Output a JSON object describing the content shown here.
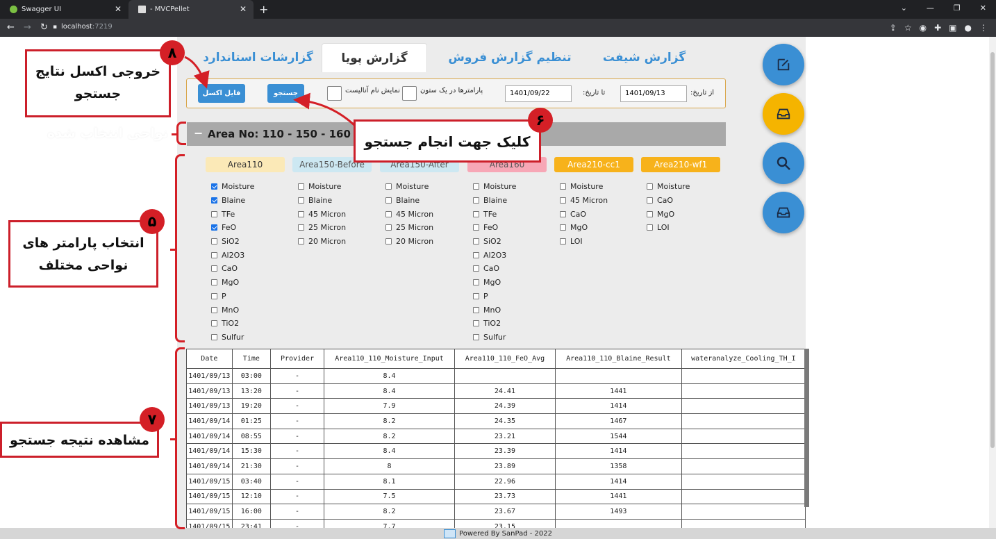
{
  "browser": {
    "tabs": [
      {
        "title": "Swagger UI"
      },
      {
        "title": "- MVCPellet"
      }
    ],
    "new_tab": "+",
    "url_host": "localhost",
    "url_port": ":7219"
  },
  "nav": {
    "tabs": [
      "گزارش شیفت",
      "تنظیم گزارش فروش",
      "گزارش پویا",
      "گزارشات استاندارد"
    ],
    "active": "گزارش پویا"
  },
  "filter": {
    "from_label": "از تاریخ:",
    "from_value": "1401/09/13",
    "to_label": "تا تاریخ:",
    "to_value": "1401/09/22",
    "one_column_label": "پارامترها در یک ستون",
    "show_analyst_label": "نمایش نام آنالیست",
    "search_button": "جستجو",
    "excel_button": "فایل اکسل"
  },
  "area_bar": {
    "toggle": "−",
    "title": "Area No: 110 - 150 - 160"
  },
  "areas": [
    {
      "name": "Area110",
      "color": "#fbe9b7",
      "text": "#333333",
      "params": [
        {
          "label": "Moisture",
          "checked": true
        },
        {
          "label": "Blaine",
          "checked": true
        },
        {
          "label": "TFe",
          "checked": false
        },
        {
          "label": "FeO",
          "checked": true
        },
        {
          "label": "SiO2",
          "checked": false
        },
        {
          "label": "Al2O3",
          "checked": false
        },
        {
          "label": "CaO",
          "checked": false
        },
        {
          "label": "MgO",
          "checked": false
        },
        {
          "label": "P",
          "checked": false
        },
        {
          "label": "MnO",
          "checked": false
        },
        {
          "label": "TiO2",
          "checked": false
        },
        {
          "label": "Sulfur",
          "checked": false
        }
      ]
    },
    {
      "name": "Area150-Before",
      "color": "#cde8f2",
      "text": "#555555",
      "params": [
        {
          "label": "Moisture",
          "checked": false
        },
        {
          "label": "Blaine",
          "checked": false
        },
        {
          "label": "45 Micron",
          "checked": false
        },
        {
          "label": "25 Micron",
          "checked": false
        },
        {
          "label": "20 Micron",
          "checked": false
        }
      ]
    },
    {
      "name": "Area150-After",
      "color": "#cde8f2",
      "text": "#555555",
      "params": [
        {
          "label": "Moisture",
          "checked": false
        },
        {
          "label": "Blaine",
          "checked": false
        },
        {
          "label": "45 Micron",
          "checked": false
        },
        {
          "label": "25 Micron",
          "checked": false
        },
        {
          "label": "20 Micron",
          "checked": false
        }
      ]
    },
    {
      "name": "Area160",
      "color": "#f7a7b6",
      "text": "#555555",
      "params": [
        {
          "label": "Moisture",
          "checked": false
        },
        {
          "label": "Blaine",
          "checked": false
        },
        {
          "label": "TFe",
          "checked": false
        },
        {
          "label": "FeO",
          "checked": false
        },
        {
          "label": "SiO2",
          "checked": false
        },
        {
          "label": "Al2O3",
          "checked": false
        },
        {
          "label": "CaO",
          "checked": false
        },
        {
          "label": "MgO",
          "checked": false
        },
        {
          "label": "P",
          "checked": false
        },
        {
          "label": "MnO",
          "checked": false
        },
        {
          "label": "TiO2",
          "checked": false
        },
        {
          "label": "Sulfur",
          "checked": false
        }
      ]
    },
    {
      "name": "Area210-cc1",
      "color": "#f7b21b",
      "text": "#ffffff",
      "params": [
        {
          "label": "Moisture",
          "checked": false
        },
        {
          "label": "45 Micron",
          "checked": false
        },
        {
          "label": "CaO",
          "checked": false
        },
        {
          "label": "MgO",
          "checked": false
        },
        {
          "label": "LOI",
          "checked": false
        }
      ]
    },
    {
      "name": "Area210-wf1",
      "color": "#f7b21b",
      "text": "#ffffff",
      "params": [
        {
          "label": "Moisture",
          "checked": false
        },
        {
          "label": "CaO",
          "checked": false
        },
        {
          "label": "MgO",
          "checked": false
        },
        {
          "label": "LOI",
          "checked": false
        }
      ]
    }
  ],
  "table": {
    "columns": [
      "Date",
      "Time",
      "Provider",
      "Area110_110_Moisture_Input",
      "Area110_110_FeO_Avg",
      "Area110_110_Blaine_Result",
      "wateranalyze_Cooling_TH_I"
    ],
    "rows": [
      [
        "1401/09/13",
        "03:00",
        "-",
        "8.4",
        "",
        "",
        ""
      ],
      [
        "1401/09/13",
        "13:20",
        "-",
        "8.4",
        "24.41",
        "1441",
        ""
      ],
      [
        "1401/09/13",
        "19:20",
        "-",
        "7.9",
        "24.39",
        "1414",
        ""
      ],
      [
        "1401/09/14",
        "01:25",
        "-",
        "8.2",
        "24.35",
        "1467",
        ""
      ],
      [
        "1401/09/14",
        "08:55",
        "-",
        "8.2",
        "23.21",
        "1544",
        ""
      ],
      [
        "1401/09/14",
        "15:30",
        "-",
        "8.4",
        "23.39",
        "1414",
        ""
      ],
      [
        "1401/09/14",
        "21:30",
        "-",
        "8",
        "23.89",
        "1358",
        ""
      ],
      [
        "1401/09/15",
        "03:40",
        "-",
        "8.1",
        "22.96",
        "1414",
        ""
      ],
      [
        "1401/09/15",
        "12:10",
        "-",
        "7.5",
        "23.73",
        "1441",
        ""
      ],
      [
        "1401/09/15",
        "16:00",
        "-",
        "8.2",
        "23.67",
        "1493",
        ""
      ],
      [
        "1401/09/15",
        "23:41",
        "-",
        "7.7",
        "23.15",
        "",
        ""
      ]
    ]
  },
  "footer": "Powered By SanPad - 2022",
  "side_buttons": [
    {
      "icon": "edit-icon",
      "color": "#3a8fd4"
    },
    {
      "icon": "inbox-icon",
      "color": "#f5b400"
    },
    {
      "icon": "search-icon",
      "color": "#3a8fd4"
    },
    {
      "icon": "inbox-icon",
      "color": "#3a8fd4"
    }
  ],
  "annotations": {
    "excel": {
      "badge": "۸",
      "text1": "خروجی اکسل نتایج",
      "text2": "جستجو"
    },
    "areas": {
      "text": "نواحی انتخاب شده"
    },
    "search": {
      "badge": "۶",
      "text": "کلیک جهت انجام جستجو"
    },
    "params": {
      "badge": "۵",
      "text1": "انتخاب پارامتر های",
      "text2": "نواحی مختلف"
    },
    "result": {
      "badge": "۷",
      "text": "مشاهده نتیجه جستجو"
    }
  }
}
